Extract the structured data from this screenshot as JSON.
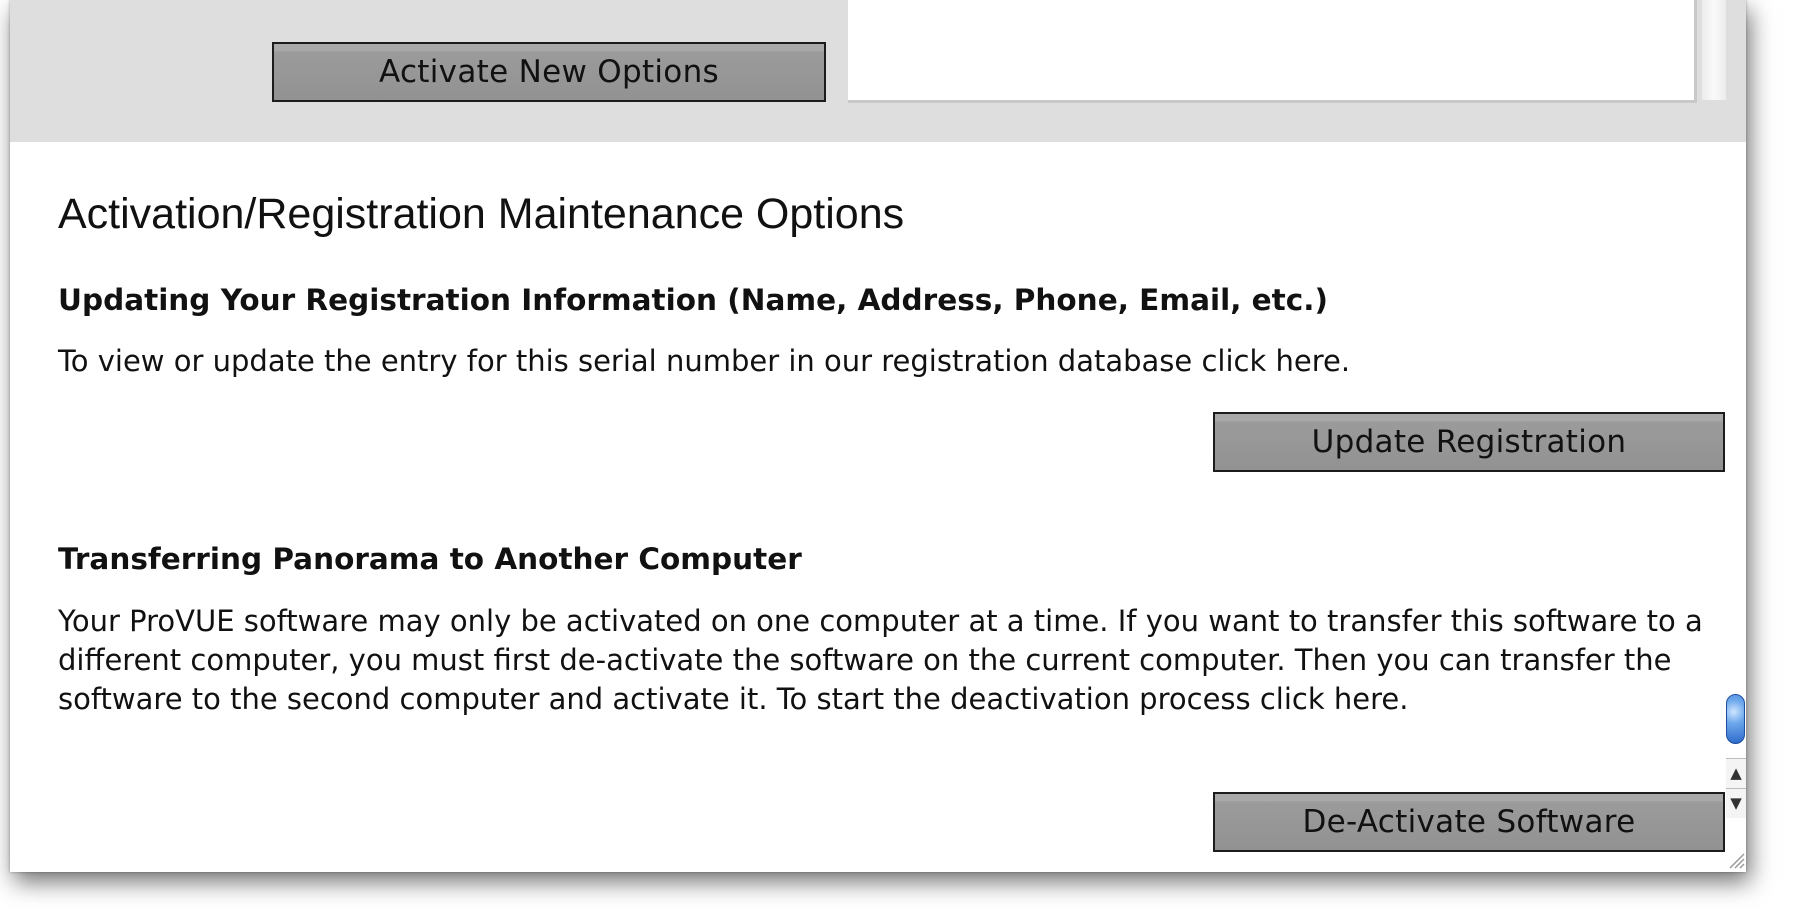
{
  "top": {
    "activate_button": "Activate New Options"
  },
  "main": {
    "title": "Activation/Registration Maintenance Options",
    "update_section": {
      "heading": "Updating Your Registration Information (Name, Address, Phone, Email, etc.)",
      "text": "To view or update the entry for this serial number in our registration database click here.",
      "button": "Update Registration"
    },
    "transfer_section": {
      "heading": "Transferring Panorama to Another Computer",
      "text": "Your ProVUE software may only be activated on one computer at a time. If you want to transfer this software to a different computer, you must first de-activate the software on the current computer. Then you can transfer the software to the second computer and activate it. To start the deactivation process click here.",
      "button": "De-Activate Software"
    }
  },
  "scrollbar": {
    "up_arrow": "▲",
    "down_arrow": "▼"
  },
  "icons": {
    "scroll_up": "up-arrow-icon",
    "scroll_down": "down-arrow-icon",
    "resize": "resize-grip-icon"
  }
}
